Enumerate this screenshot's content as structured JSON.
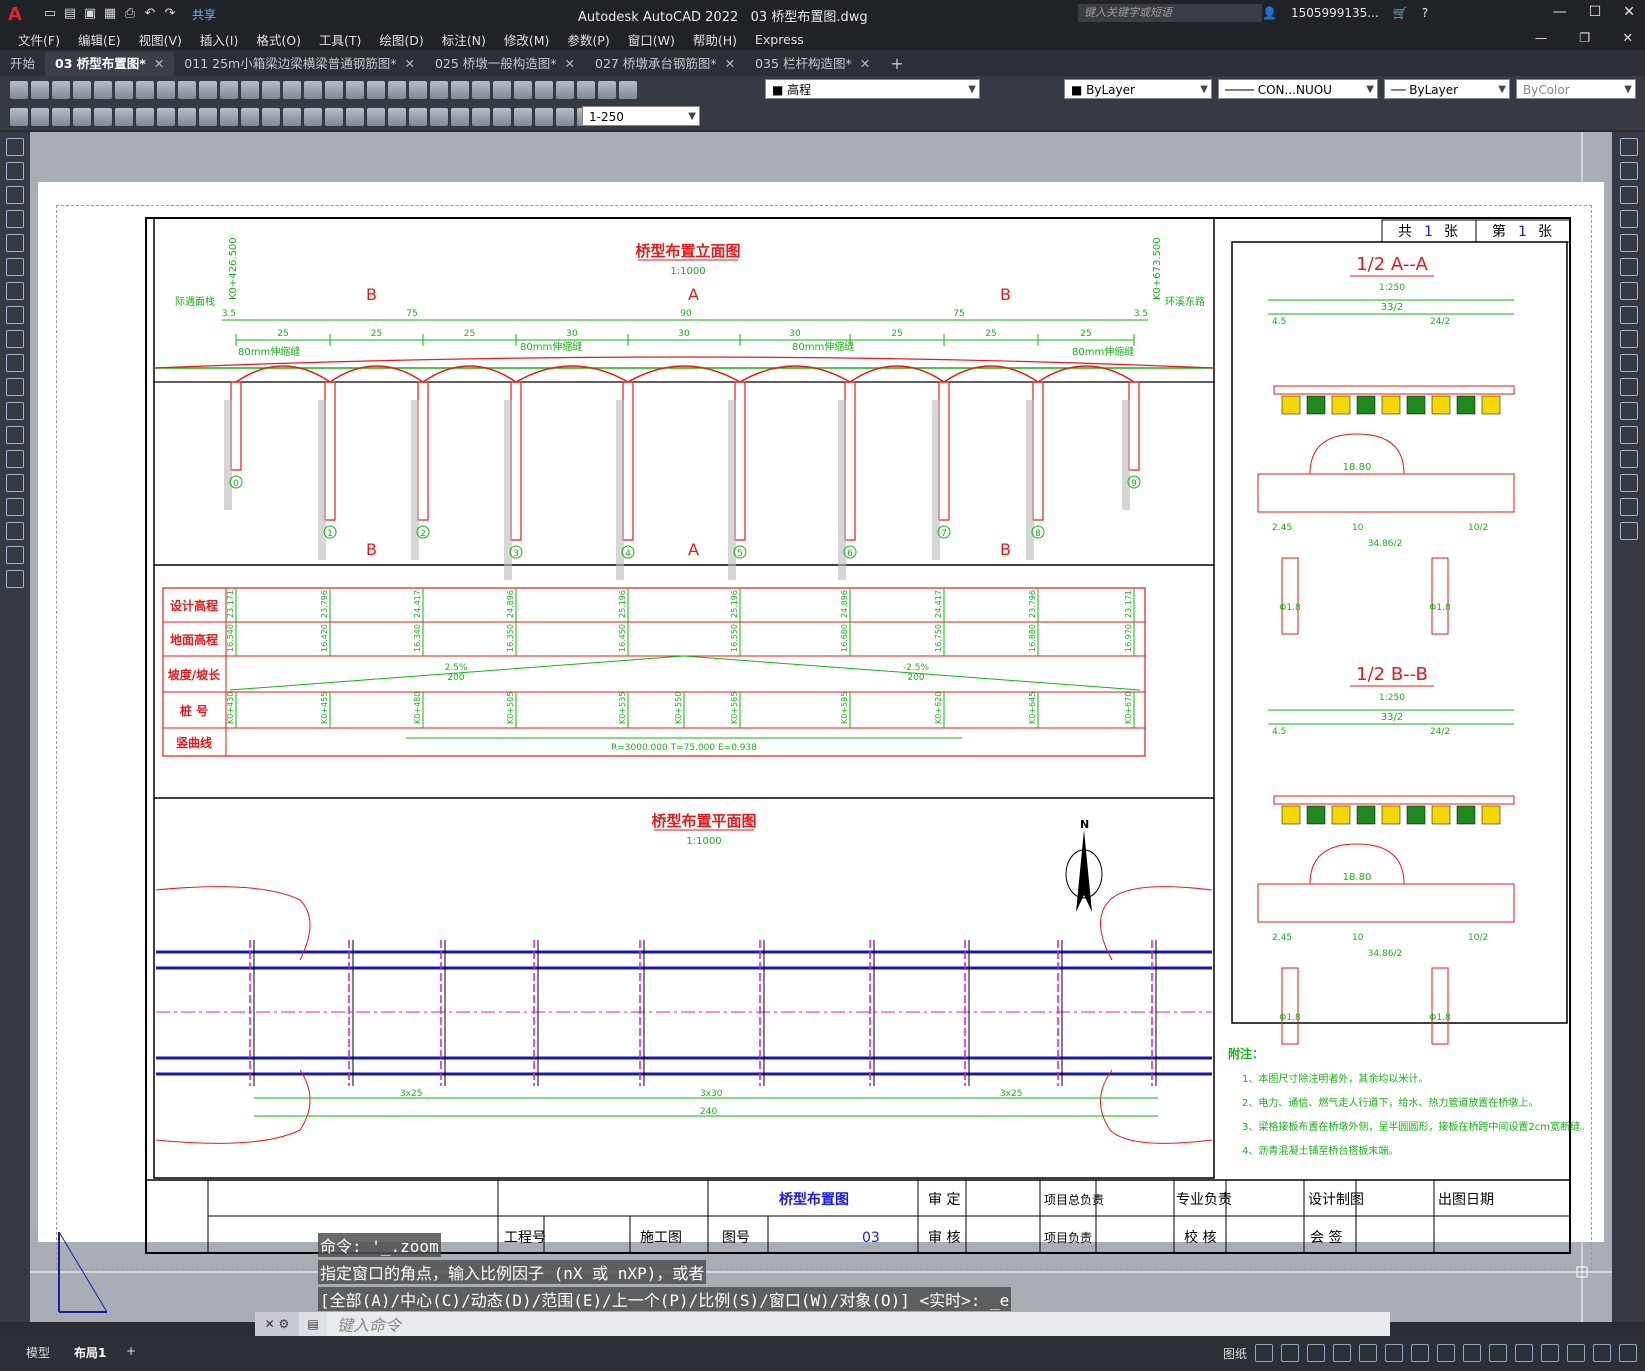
{
  "app": {
    "title": "Autodesk AutoCAD 2022",
    "drawing": "03  桥型布置图.dwg",
    "share": "共享",
    "search_placeholder": "键入关键字或短语",
    "user": "1505999135..."
  },
  "menu": [
    "文件(F)",
    "编辑(E)",
    "视图(V)",
    "插入(I)",
    "格式(O)",
    "工具(T)",
    "绘图(D)",
    "标注(N)",
    "修改(M)",
    "参数(P)",
    "窗口(W)",
    "帮助(H)",
    "Express"
  ],
  "tabs": [
    {
      "label": "开始",
      "active": false
    },
    {
      "label": "03  桥型布置图*",
      "active": true
    },
    {
      "label": "011 25m小箱梁边梁横梁普通钢筋图*",
      "active": false
    },
    {
      "label": "025 桥墩一般构造图*",
      "active": false
    },
    {
      "label": "027 桥墩承台钢筋图*",
      "active": false
    },
    {
      "label": "035 栏杆构造图*",
      "active": false
    }
  ],
  "toolbar": {
    "layer": "高程",
    "color": "ByLayer",
    "linetype": "CON...NUOU",
    "lineweight": "ByLayer",
    "plotstyle": "ByColor",
    "scale": "1-250"
  },
  "drawing": {
    "elev_title": "桥型布置立面图",
    "elev_scale": "1:1000",
    "plan_title": "桥型布置平面图",
    "plan_scale": "1:1000",
    "left_note": "际遇面栈",
    "right_note": "环溪东路",
    "left_station": "K0+426.500",
    "right_station": "K0+673.500",
    "section_mark_B": "B",
    "section_mark_A": "A",
    "dims_top": [
      "3.5",
      "75",
      "90",
      "75",
      "3.5"
    ],
    "dims_span": [
      "25",
      "25",
      "25",
      "30",
      "30",
      "30",
      "25",
      "25",
      "25"
    ],
    "joint_label": "80mm伸缩缝",
    "pier_labels": [
      "0",
      "1",
      "2",
      "3",
      "4",
      "5",
      "6",
      "7",
      "8",
      "9"
    ],
    "profile_rows": [
      "设计高程",
      "地面高程",
      "坡度/坡长",
      "桩  号",
      "竖曲线"
    ],
    "design_elev": [
      "23.171",
      "23.796",
      "24.417",
      "24.896",
      "25.196",
      "25.196",
      "24.896",
      "24.417",
      "23.796",
      "23.171"
    ],
    "ground_elev": [
      "16.540",
      "16.420",
      "16.340",
      "16.350",
      "16.450",
      "16.550",
      "16.680",
      "16.750",
      "16.880",
      "16.970"
    ],
    "stations": [
      "K0+430",
      "K0+455",
      "K0+480",
      "K0+505",
      "K0+535",
      "K0+550",
      "K0+565",
      "K0+595",
      "K0+620",
      "K0+645",
      "K0+670"
    ],
    "grade_left": "2.5%",
    "grade_left_len": "200",
    "grade_right": "-2.5%",
    "grade_right_len": "200",
    "vc": "R=3000.000      T=75.000      E=0.938",
    "plan_dims": [
      "3x25",
      "3x30",
      "3x25"
    ],
    "plan_total": "240",
    "north": "N"
  },
  "sheet": {
    "total_label": "共",
    "total": "1",
    "unit": "张",
    "index_label": "第",
    "index": "1"
  },
  "sections": [
    {
      "title": "1/2  A--A",
      "scale": "1:250",
      "width": "33/2",
      "half": "24/2",
      "side": "4.5",
      "h": "18.80",
      "bottom": "34.86/2",
      "left": "2.45",
      "mid": "10",
      "right": "10/2",
      "pile": "Φ1.8"
    },
    {
      "title": "1/2  B--B",
      "scale": "1:250",
      "width": "33/2",
      "half": "24/2",
      "side": "4.5",
      "h": "18.80",
      "bottom": "34.86/2",
      "left": "2.45",
      "mid": "10",
      "right": "10/2",
      "pile": "Φ1.8"
    }
  ],
  "notes": {
    "title": "附注：",
    "items": [
      "1、本图尺寸除注明者外，其余均以米计。",
      "2、电力、通信、燃气走人行道下，给水、热力管道放置在桥墩上。",
      "3、梁格接板布置在桥墩外侧，呈半圆圆形，接板在桥跨中间设置2cm宽断缝。",
      "4、沥青混凝土铺至桥台搭板末端。"
    ]
  },
  "titleblock": {
    "drawing_name": "桥型布置图",
    "proj_no": "工程号",
    "stage": "施工图",
    "fig_no_label": "图号",
    "fig_no": "03",
    "approve": "审 定",
    "review": "审 核",
    "proj_lead": "项目总负责",
    "proj_owner": "项目负责",
    "spec_lead": "专业负责",
    "check": "校 核",
    "design": "设计制图",
    "countersign": "会  签",
    "issue_date": "出图日期"
  },
  "command": {
    "lines": [
      "命令: '_.zoom",
      "指定窗口的角点，输入比例因子 (nX 或 nXP)，或者",
      "[全部(A)/中心(C)/动态(D)/范围(E)/上一个(P)/比例(S)/窗口(W)/对象(O)] <实时>: _e"
    ],
    "placeholder": "键入命令"
  },
  "status": {
    "model": "模型",
    "layout": "布局1",
    "paper": "图纸"
  }
}
